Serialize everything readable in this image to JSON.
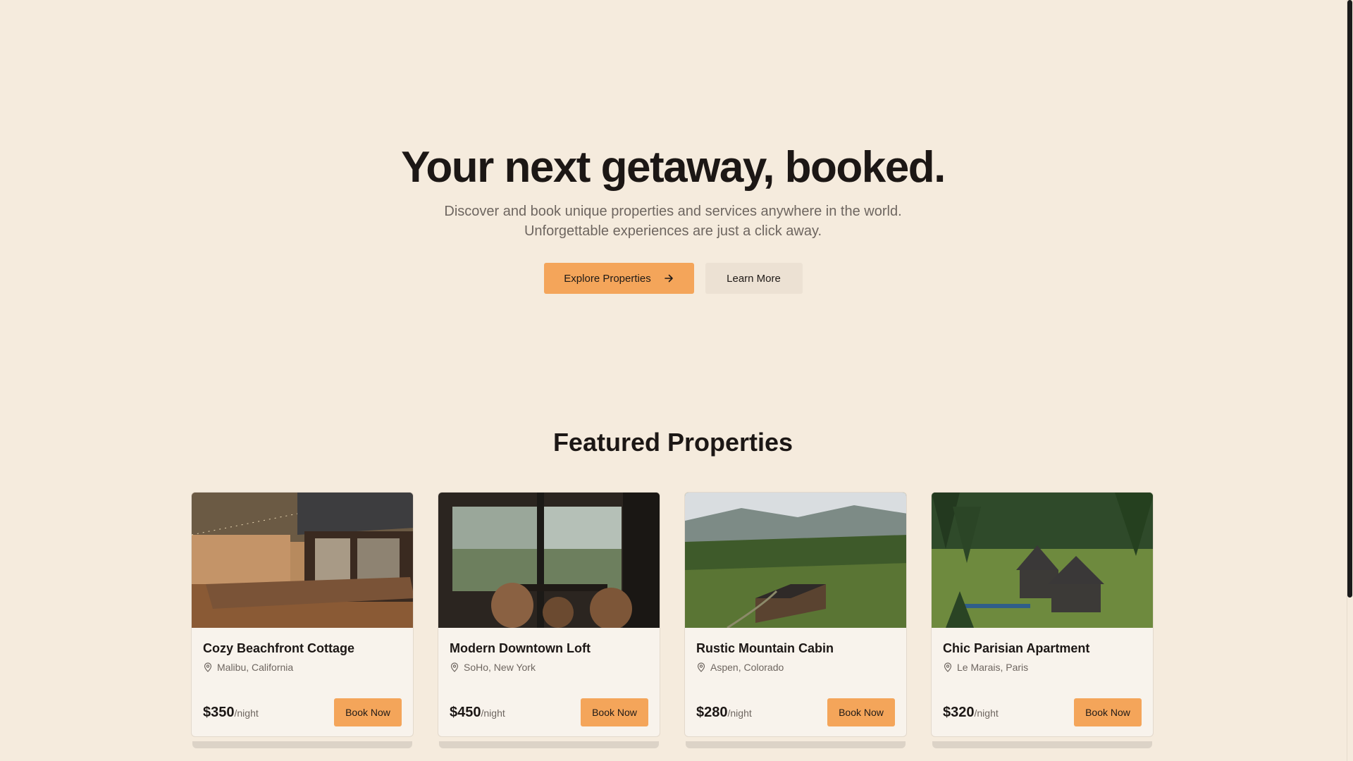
{
  "hero": {
    "title": "Your next getaway, booked.",
    "subtitle_line1": "Discover and book unique properties and services anywhere in the world.",
    "subtitle_line2": "Unforgettable experiences are just a click away.",
    "primary_button": "Explore Properties",
    "secondary_button": "Learn More"
  },
  "featured": {
    "title": "Featured Properties",
    "price_unit": "/night",
    "book_label": "Book Now",
    "properties": [
      {
        "name": "Cozy Beachfront Cottage",
        "location": "Malibu, California",
        "price": "$350"
      },
      {
        "name": "Modern Downtown Loft",
        "location": "SoHo, New York",
        "price": "$450"
      },
      {
        "name": "Rustic Mountain Cabin",
        "location": "Aspen, Colorado",
        "price": "$280"
      },
      {
        "name": "Chic Parisian Apartment",
        "location": "Le Marais, Paris",
        "price": "$320"
      }
    ]
  },
  "colors": {
    "background": "#f5ebdd",
    "accent": "#f4a55a",
    "secondary_button": "#ece1d3",
    "card": "#f8f3ec"
  },
  "icons": {
    "primary_button": "arrow-right-icon",
    "location": "map-pin-icon"
  }
}
